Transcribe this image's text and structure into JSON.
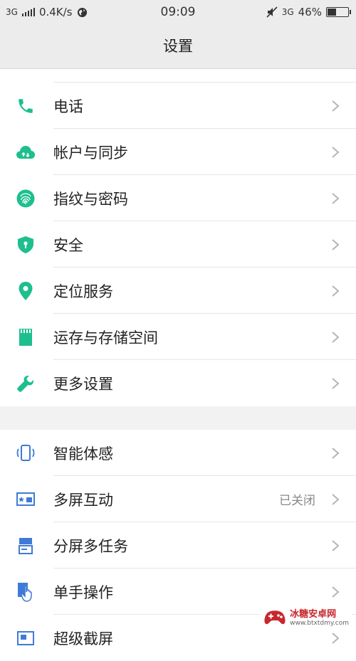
{
  "status_bar": {
    "network_left": "3G",
    "speed": "0.4K/s",
    "time": "09:09",
    "network_right": "3G",
    "battery": "46%",
    "battery_level": 0.46
  },
  "header": {
    "title": "设置"
  },
  "group1": [
    {
      "label": "电话",
      "icon": "phone-icon"
    },
    {
      "label": "帐户与同步",
      "icon": "cloud-sync-icon"
    },
    {
      "label": "指纹与密码",
      "icon": "fingerprint-icon"
    },
    {
      "label": "安全",
      "icon": "shield-icon"
    },
    {
      "label": "定位服务",
      "icon": "location-pin-icon"
    },
    {
      "label": "运存与存储空间",
      "icon": "sd-card-icon"
    },
    {
      "label": "更多设置",
      "icon": "wrench-icon"
    }
  ],
  "group2": [
    {
      "label": "智能体感",
      "icon": "motion-phone-icon",
      "value": ""
    },
    {
      "label": "多屏互动",
      "icon": "screen-cast-icon",
      "value": "已关闭"
    },
    {
      "label": "分屏多任务",
      "icon": "split-screen-icon",
      "value": ""
    },
    {
      "label": "单手操作",
      "icon": "one-hand-icon",
      "value": ""
    },
    {
      "label": "超级截屏",
      "icon": "screenshot-icon",
      "value": ""
    }
  ],
  "colors": {
    "green": "#1dbf8e",
    "blue": "#3f7bd6",
    "header_bg": "#ececec"
  },
  "watermark": {
    "name": "冰糖安卓网",
    "url": "www.btxtdmy.com"
  }
}
